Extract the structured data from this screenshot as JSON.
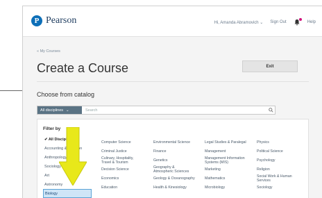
{
  "header": {
    "logo_letter": "P",
    "logo_text": "Pearson",
    "greeting": "Hi, Amanda Abramovich ⌄",
    "sign_out": "Sign Out",
    "help": "Help"
  },
  "page": {
    "breadcrumb": "« My Courses",
    "title": "Create a Course",
    "exit_label": "Exit"
  },
  "catalog": {
    "title": "Choose from catalog",
    "discipline_select": "All disciplines",
    "search_placeholder": "Search",
    "filter_title": "Filter by",
    "filter_items": [
      "✔ All Disciplines",
      "Accounting & Taxation",
      "Anthropology",
      "Sociology",
      "Art",
      "Astronomy",
      "Biology"
    ],
    "columns": [
      [
        "Computer Science",
        "Criminal Justice",
        "Culinary, Hospitality, Travel & Tourism",
        "Decision Science",
        "Economics",
        "Education",
        ""
      ],
      [
        "Environmental Science",
        "Finance",
        "Genetics",
        "Geography & Atmospheric Sciences",
        "Geology & Oceanography",
        "Health & Kinesiology"
      ],
      [
        "Legal Studies & Paralegal",
        "Management",
        "Management Information Systems (MIS)",
        "Marketing",
        "Mathematics",
        "Microbiology"
      ],
      [
        "Physics",
        "Political Science",
        "Psychology",
        "Religion",
        "Social Work & Human Services",
        "Sociology"
      ]
    ]
  },
  "colors": {
    "accent_blue": "#0d6fb8",
    "select_bg": "#5a7384",
    "highlight_arrow": "#e8e81a",
    "selected_item_bg": "#cfe5f7"
  }
}
